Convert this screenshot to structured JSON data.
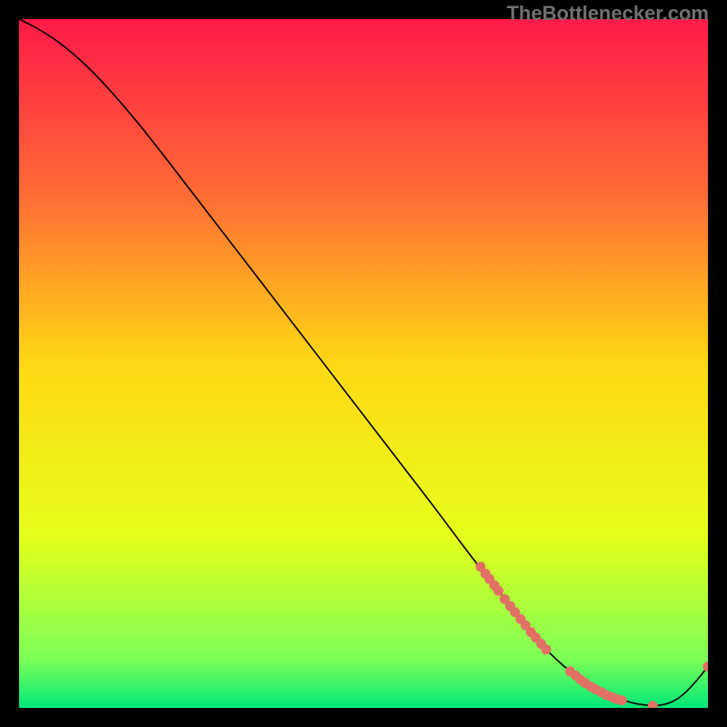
{
  "watermark": "TheBottlenecker.com",
  "chart_data": {
    "type": "line",
    "title": "",
    "xlabel": "",
    "ylabel": "",
    "xlim": [
      0,
      100
    ],
    "ylim": [
      0,
      100
    ],
    "background_gradient": {
      "stops": [
        {
          "offset": 0,
          "color": "#ff1a48"
        },
        {
          "offset": 25,
          "color": "#ff6a36"
        },
        {
          "offset": 50,
          "color": "#ffd814"
        },
        {
          "offset": 75,
          "color": "#e6ff1a"
        },
        {
          "offset": 93,
          "color": "#7cff58"
        },
        {
          "offset": 100,
          "color": "#00e878"
        }
      ]
    },
    "series": [
      {
        "name": "bottleneck-curve",
        "type": "line",
        "color": "#000000",
        "x": [
          0,
          3,
          6,
          9,
          12,
          16,
          20,
          25,
          30,
          35,
          40,
          45,
          50,
          55,
          60,
          63,
          66,
          70,
          73,
          76,
          78,
          80,
          82,
          84,
          86,
          88,
          90,
          92,
          94,
          96,
          98,
          100
        ],
        "y": [
          100,
          98.5,
          96.5,
          94,
          91,
          86.5,
          81.5,
          75,
          68.5,
          62,
          55.5,
          49,
          42.5,
          36,
          29.5,
          25.5,
          21.5,
          16.5,
          12.5,
          9,
          7,
          5.3,
          3.8,
          2.6,
          1.7,
          1.0,
          0.5,
          0.3,
          0.5,
          1.5,
          3.5,
          6
        ]
      },
      {
        "name": "highlight-points",
        "type": "scatter",
        "color": "#e27065",
        "points": [
          {
            "x": 67,
            "y": 20.5
          },
          {
            "x": 67.7,
            "y": 19.5
          },
          {
            "x": 68.3,
            "y": 18.7
          },
          {
            "x": 69,
            "y": 17.8
          },
          {
            "x": 69.6,
            "y": 17
          },
          {
            "x": 70.5,
            "y": 15.8
          },
          {
            "x": 71.3,
            "y": 14.8
          },
          {
            "x": 72,
            "y": 13.9
          },
          {
            "x": 72.8,
            "y": 12.9
          },
          {
            "x": 73.5,
            "y": 12
          },
          {
            "x": 74.3,
            "y": 11
          },
          {
            "x": 75,
            "y": 10.2
          },
          {
            "x": 75.8,
            "y": 9.3
          },
          {
            "x": 76.5,
            "y": 8.5
          },
          {
            "x": 80,
            "y": 5.3
          },
          {
            "x": 80.8,
            "y": 4.7
          },
          {
            "x": 81.5,
            "y": 4.1
          },
          {
            "x": 82.2,
            "y": 3.6
          },
          {
            "x": 83,
            "y": 3.1
          },
          {
            "x": 83.7,
            "y": 2.7
          },
          {
            "x": 84.5,
            "y": 2.3
          },
          {
            "x": 85.2,
            "y": 1.9
          },
          {
            "x": 86,
            "y": 1.6
          },
          {
            "x": 86.7,
            "y": 1.3
          },
          {
            "x": 87.5,
            "y": 1.1
          },
          {
            "x": 92,
            "y": 0.3
          },
          {
            "x": 100,
            "y": 6
          }
        ]
      }
    ]
  }
}
